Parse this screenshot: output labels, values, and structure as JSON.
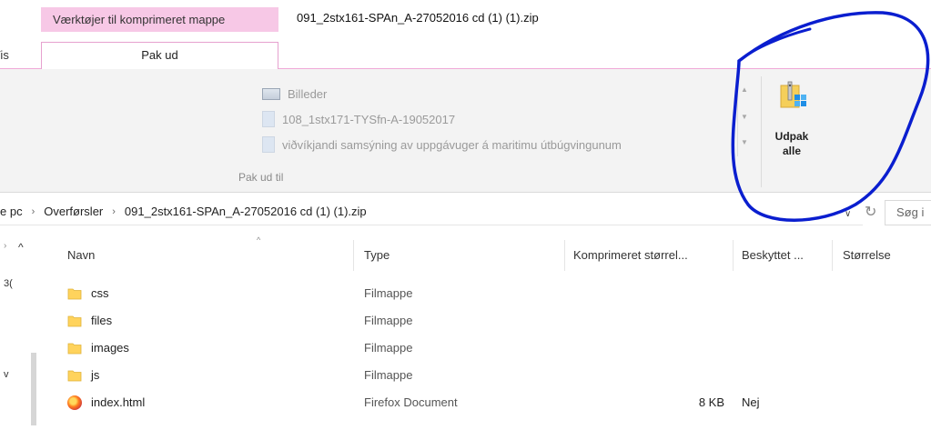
{
  "window": {
    "contextual_tab_group": "Værktøjer til komprimeret mappe",
    "title": "091_2stx161-SPAn_A-27052016 cd (1) (1).zip"
  },
  "tabs": {
    "vis": "Vis",
    "pak_ud": "Pak ud"
  },
  "ribbon": {
    "gallery_items": [
      {
        "label": "Billeder",
        "icon": "pictures-folder-icon"
      },
      {
        "label": "108_1stx171-TYSfn-A-19052017",
        "icon": "document-icon"
      },
      {
        "label": "viðvíkjandi samsýning av uppgávuger á maritimu útbúgvingunum",
        "icon": "document-icon"
      }
    ],
    "group_label": "Pak ud til",
    "extract_all_label": "Udpak alle",
    "extract_all_icon": "zip-extract-icon"
  },
  "address_bar": {
    "crumbs": [
      "e pc",
      "Overførsler",
      "091_2stx161-SPAn_A-27052016 cd (1) (1).zip"
    ],
    "search_placeholder": "Søg i"
  },
  "nav_pane": {
    "text_1": "3(",
    "text_2": "v"
  },
  "file_list": {
    "columns": [
      "Navn",
      "Type",
      "Komprimeret størrel...",
      "Beskyttet ...",
      "Størrelse"
    ],
    "rows": [
      {
        "name": "css",
        "type": "Filmappe",
        "compressed": "",
        "protected": "",
        "size": "",
        "icon": "folder-icon"
      },
      {
        "name": "files",
        "type": "Filmappe",
        "compressed": "",
        "protected": "",
        "size": "",
        "icon": "folder-icon"
      },
      {
        "name": "images",
        "type": "Filmappe",
        "compressed": "",
        "protected": "",
        "size": "",
        "icon": "folder-icon"
      },
      {
        "name": "js",
        "type": "Filmappe",
        "compressed": "",
        "protected": "",
        "size": "",
        "icon": "folder-icon"
      },
      {
        "name": "index.html",
        "type": "Firefox Document",
        "compressed": "8 KB",
        "protected": "Nej",
        "size": "",
        "icon": "firefox-document-icon"
      }
    ]
  },
  "colors": {
    "contextual_tab": "#f7c8e6",
    "annotation_ink": "#0a1ecf",
    "folder": "#ffd35c"
  }
}
